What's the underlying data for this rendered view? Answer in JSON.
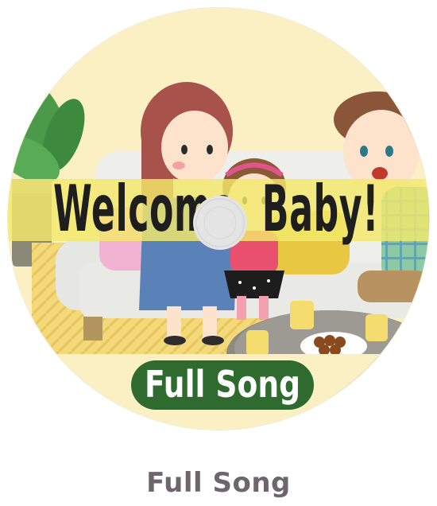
{
  "disc": {
    "title": "Welcome, Baby!",
    "label": "Full Song",
    "colors": {
      "background": "#faf0c4",
      "title_band": "#f3e96a",
      "label_pill": "#2f6a2e",
      "label_text": "#ffffff",
      "spindle_hole": "#e4e4e4"
    }
  },
  "caption": {
    "text": "Full Song",
    "color": "#6d666b"
  }
}
